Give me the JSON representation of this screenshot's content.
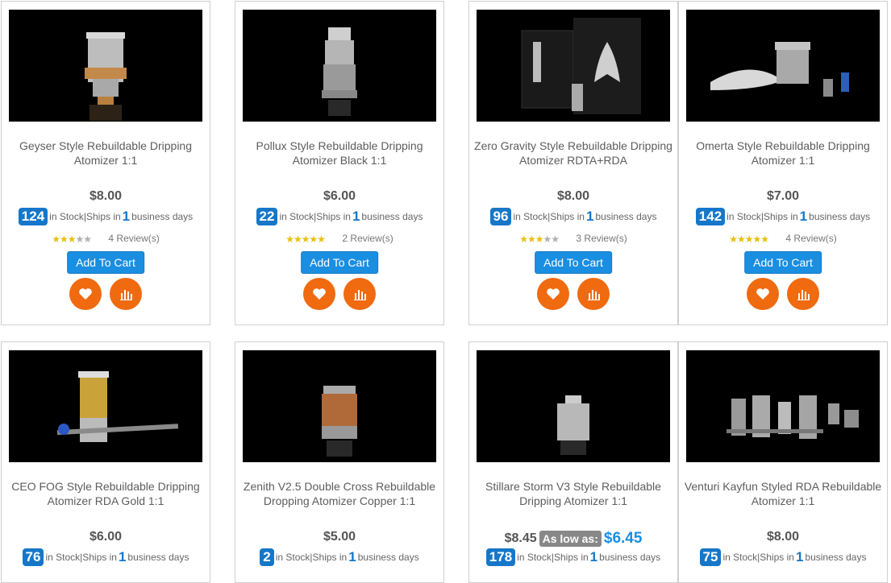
{
  "products": [
    {
      "title": "Geyser Style Rebuildable Dripping Atomizer 1:1",
      "price": "$8.00",
      "stock": "124",
      "ships_days": "1",
      "reviews": "4 Review(s)",
      "stars": 3,
      "cart": "Add To Cart",
      "fav_icon": "heart-icon",
      "compare_icon": "chart-icon"
    },
    {
      "title": "Pollux Style Rebuildable Dripping Atomizer Black 1:1",
      "price": "$6.00",
      "stock": "22",
      "ships_days": "1",
      "reviews": "2 Review(s)",
      "stars": 5,
      "cart": "Add To Cart",
      "fav_icon": "heart-icon",
      "compare_icon": "chart-icon"
    },
    {
      "title": "Zero Gravity Style Rebuildable Dripping Atomizer RDTA+RDA",
      "price": "$8.00",
      "stock": "96",
      "ships_days": "1",
      "reviews": "3 Review(s)",
      "stars": 3.5,
      "cart": "Add To Cart",
      "fav_icon": "heart-icon",
      "compare_icon": "chart-icon"
    },
    {
      "title": "Omerta Style Rebuildable Dripping Atomizer 1:1",
      "price": "$7.00",
      "stock": "142",
      "ships_days": "1",
      "reviews": "4 Review(s)",
      "stars": 5,
      "cart": "Add To Cart",
      "fav_icon": "heart-icon",
      "compare_icon": "chart-icon"
    },
    {
      "title": "CEO FOG Style Rebuildable Dripping Atomizer RDA Gold 1:1",
      "price": "$6.00",
      "stock": "76",
      "ships_days": "1"
    },
    {
      "title": "Zenith V2.5 Double Cross Rebuildable Dropping Atomizer Copper 1:1",
      "price": "$5.00",
      "stock": "2",
      "ships_days": "1"
    },
    {
      "title": "Stillare Storm V3 Style Rebuildable Dripping Atomizer 1:1",
      "old_price": "$8.45",
      "as_low_as": "As low as:",
      "price": "$6.45",
      "stock": "178",
      "ships_days": "1"
    },
    {
      "title": "Venturi Kayfun Styled RDA Rebuildable Atomizer 1:1",
      "price": "$8.00",
      "stock": "75",
      "ships_days": "1"
    }
  ],
  "labels": {
    "in_stock": "in Stock|Ships in",
    "business_days": "business days"
  },
  "colors": {
    "accent_blue": "#1a8ee1",
    "stock_badge": "#1677c9",
    "action_orange": "#f06a10",
    "star_gold": "#e6c012"
  }
}
